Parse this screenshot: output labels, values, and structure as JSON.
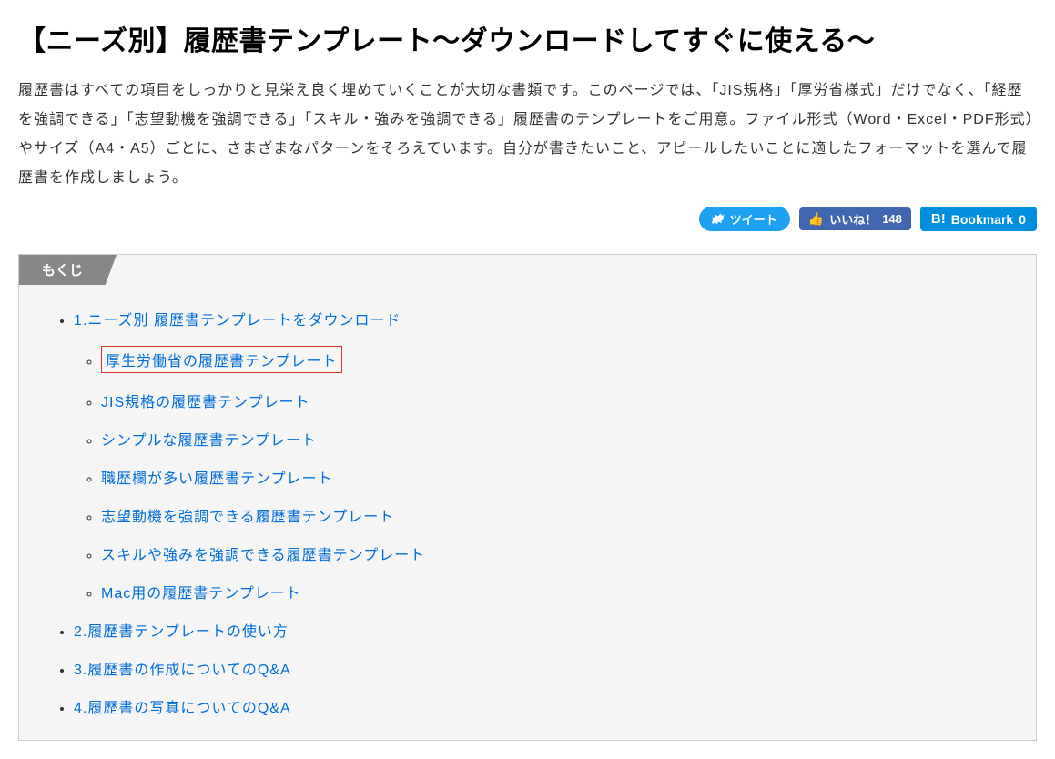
{
  "title": "【ニーズ別】履歴書テンプレート～ダウンロードしてすぐに使える～",
  "intro": "履歴書はすべての項目をしっかりと見栄え良く埋めていくことが大切な書類です。このページでは、「JIS規格」「厚労省様式」だけでなく、「経歴を強調できる」「志望動機を強調できる」「スキル・強みを強調できる」履歴書のテンプレートをご用意。ファイル形式（Word・Excel・PDF形式）やサイズ（A4・A5）ごとに、さまざまなパターンをそろえています。自分が書きたいこと、アピールしたいことに適したフォーマットを選んで履歴書を作成しましょう。",
  "social": {
    "tweet_label": "ツイート",
    "like_label": "いいね！",
    "like_count": "148",
    "bookmark_label": "Bookmark",
    "bookmark_count": "0"
  },
  "toc": {
    "header": "もくじ",
    "items": [
      {
        "label": "1.ニーズ別 履歴書テンプレートをダウンロード",
        "children": [
          {
            "label": "厚生労働省の履歴書テンプレート",
            "highlighted": true
          },
          {
            "label": "JIS規格の履歴書テンプレート"
          },
          {
            "label": "シンプルな履歴書テンプレート"
          },
          {
            "label": "職歴欄が多い履歴書テンプレート"
          },
          {
            "label": "志望動機を強調できる履歴書テンプレート"
          },
          {
            "label": "スキルや強みを強調できる履歴書テンプレート"
          },
          {
            "label": "Mac用の履歴書テンプレート"
          }
        ]
      },
      {
        "label": "2.履歴書テンプレートの使い方"
      },
      {
        "label": "3.履歴書の作成についてのQ&A"
      },
      {
        "label": "4.履歴書の写真についてのQ&A"
      }
    ]
  }
}
